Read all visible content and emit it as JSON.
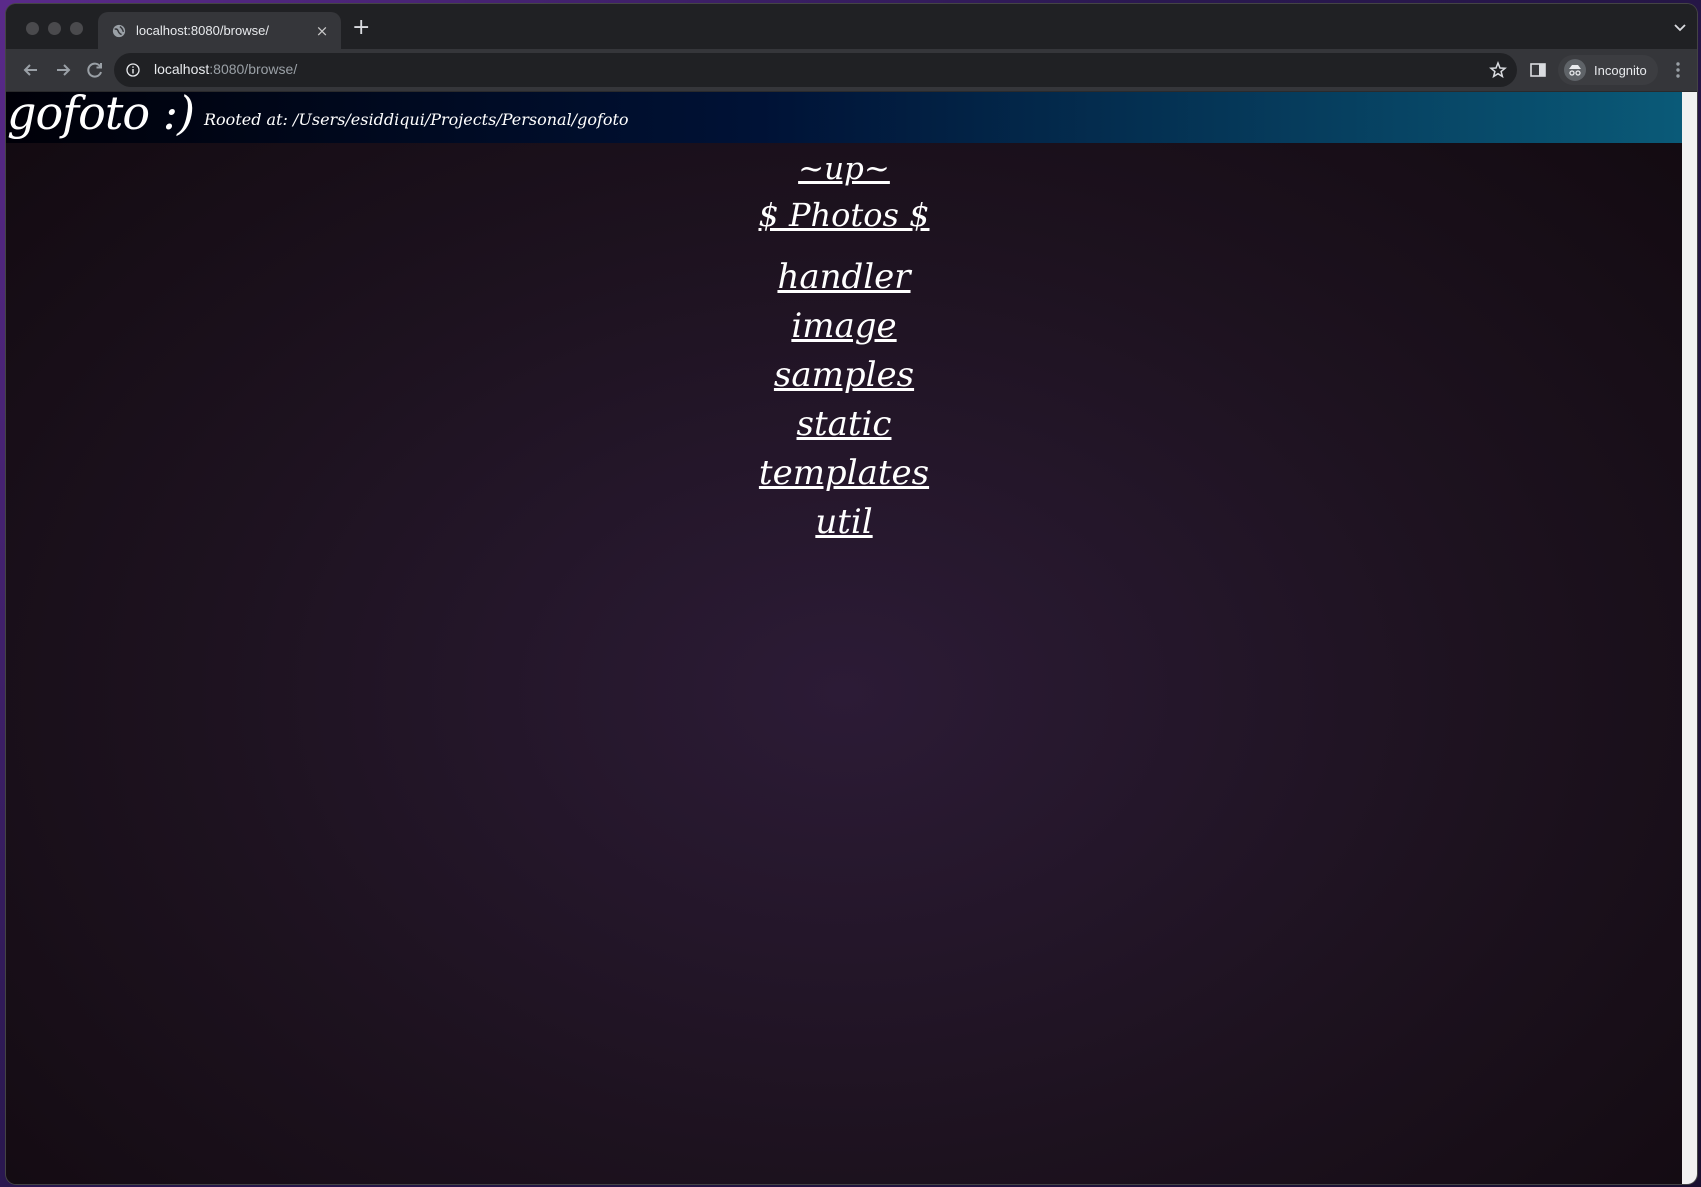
{
  "browser": {
    "tab_title": "localhost:8080/browse/",
    "new_tab_label": "+",
    "close_tab_label": "×",
    "url_host": "localhost",
    "url_rest": ":8080/browse/",
    "profile_label": "Incognito",
    "icons": [
      "globe-icon",
      "back-icon",
      "forward-icon",
      "reload-icon",
      "info-icon",
      "star-icon",
      "sidepanel-icon",
      "incognito-icon",
      "menu-icon"
    ]
  },
  "page": {
    "logo": "gofoto :)",
    "rooted_text": "Rooted at: /Users/esiddiqui/Projects/Personal/gofoto",
    "up_link": "~up~",
    "photos_link": "$ Photos $",
    "directories": [
      "handler",
      "image",
      "samples",
      "static",
      "templates",
      "util"
    ]
  }
}
